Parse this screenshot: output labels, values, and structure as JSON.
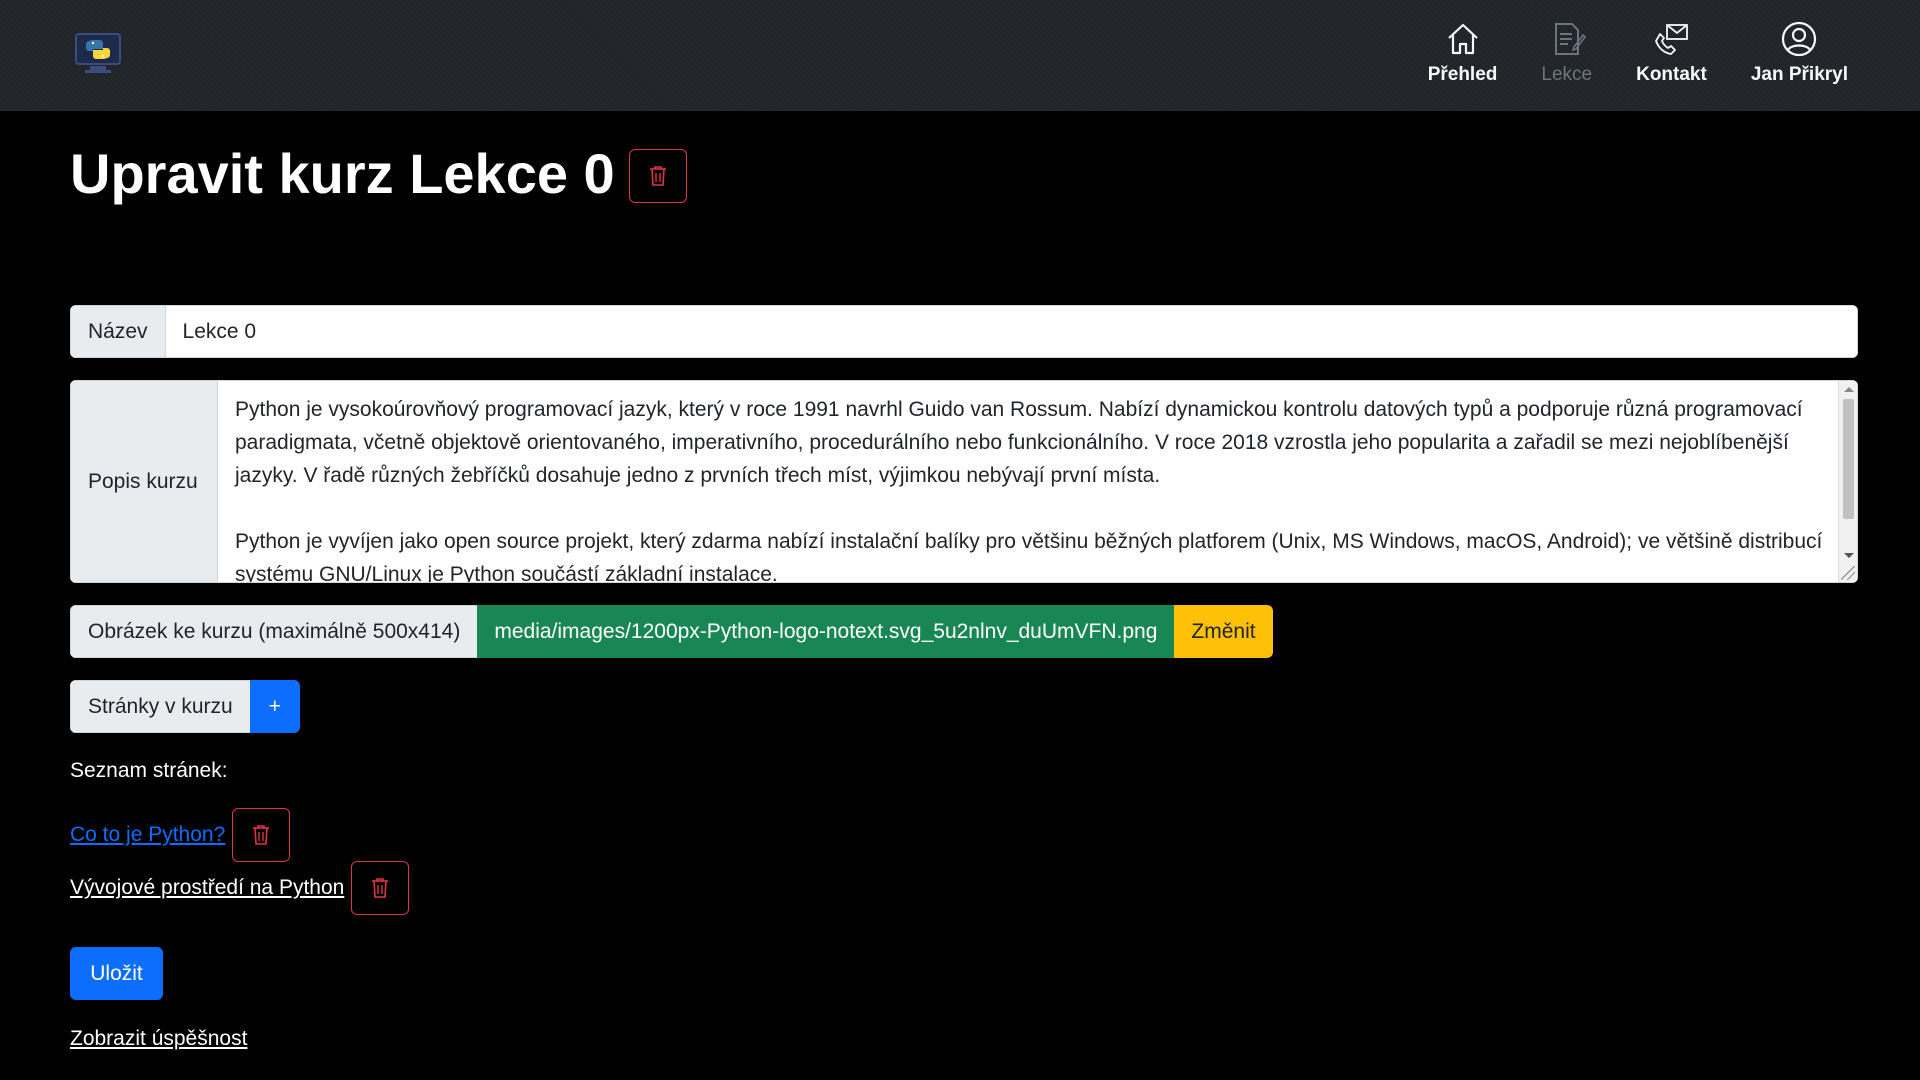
{
  "nav": {
    "items": [
      {
        "label": "Přehled",
        "icon": "home-icon"
      },
      {
        "label": "Lekce",
        "icon": "lesson-icon"
      },
      {
        "label": "Kontakt",
        "icon": "contact-icon"
      },
      {
        "label": "Jan Přikryl",
        "icon": "user-icon"
      }
    ]
  },
  "page": {
    "title": "Upravit kurz Lekce 0"
  },
  "form": {
    "name_label": "Název",
    "name_value": "Lekce 0",
    "desc_label": "Popis kurzu",
    "desc_p1": "Python je vysokoúrovňový programovací jazyk, který v roce 1991 navrhl Guido van Rossum. Nabízí dynamickou kontrolu datových typů a podporuje různá programovací paradigmata, včetně objektově orientovaného, imperativního, procedurálního nebo funkcionálního. V roce 2018 vzrostla jeho popularita a zařadil se mezi nejoblíbenější jazyky. V řadě různých žebříčků dosahuje jedno z prvních třech míst, výjimkou nebývají první místa.",
    "desc_p2": "Python je vyvíjen jako open source projekt, který zdarma nabízí instalační balíky pro většinu běžných platforem (Unix, MS Windows, macOS, Android); ve většině distribucí systému GNU/Linux je Python součástí základní instalace.",
    "image_label": "Obrázek ke kurzu (maximálně 500x414)",
    "image_path": "media/images/1200px-Python-logo-notext.svg_5u2nlnv_duUmVFN.png",
    "image_change": "Změnit",
    "pages_label": "Stránky v kurzu",
    "pages_add": "+"
  },
  "pages_list": {
    "label": "Seznam stránek:",
    "items": [
      {
        "title": "Co to je Python?"
      },
      {
        "title": "Vývojové prostředí na Python"
      }
    ]
  },
  "actions": {
    "save": "Uložit",
    "show_success": "Zobrazit úspěšnost"
  },
  "colors": {
    "navbar": "#212529",
    "primary": "#0d6efd",
    "success": "#198754",
    "warning": "#ffc107",
    "danger": "#dc3545"
  }
}
